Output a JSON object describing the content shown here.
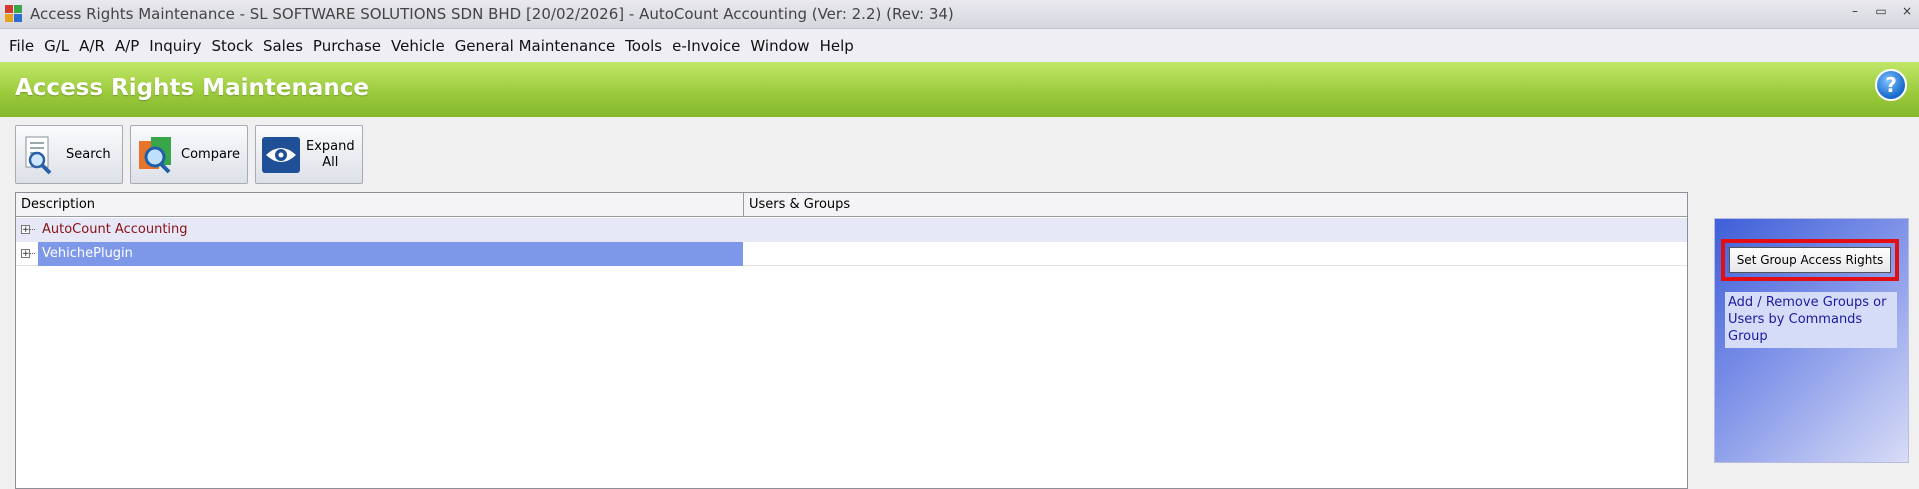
{
  "window": {
    "title": "Access Rights Maintenance - SL SOFTWARE SOLUTIONS SDN BHD [20/02/2026] - AutoCount Accounting (Ver: 2.2) (Rev: 34)",
    "controls": {
      "minimize": "–",
      "restore": "▭",
      "close": "×"
    }
  },
  "menu": [
    "File",
    "G/L",
    "A/R",
    "A/P",
    "Inquiry",
    "Stock",
    "Sales",
    "Purchase",
    "Vehicle",
    "General Maintenance",
    "Tools",
    "e-Invoice",
    "Window",
    "Help"
  ],
  "header": {
    "title": "Access Rights Maintenance",
    "help_glyph": "?"
  },
  "toolbar": {
    "search_label": "Search",
    "compare_label": "Compare",
    "expand_label_1": "Expand",
    "expand_label_2": "All"
  },
  "grid": {
    "columns": [
      "Description",
      "Users & Groups"
    ],
    "rows": [
      {
        "description": "AutoCount Accounting",
        "users": "",
        "expander": "+"
      },
      {
        "description": "VehichePlugin",
        "users": "",
        "expander": "+"
      }
    ]
  },
  "side_panel": {
    "button_label": "Set Group Access Rights",
    "description": "Add / Remove Groups or Users by Commands Group"
  },
  "colors": {
    "banner_green": "#98c93a",
    "selected_row": "#7d98e8",
    "row_text_red": "#8a1111",
    "highlight_outline": "#e10e16"
  }
}
